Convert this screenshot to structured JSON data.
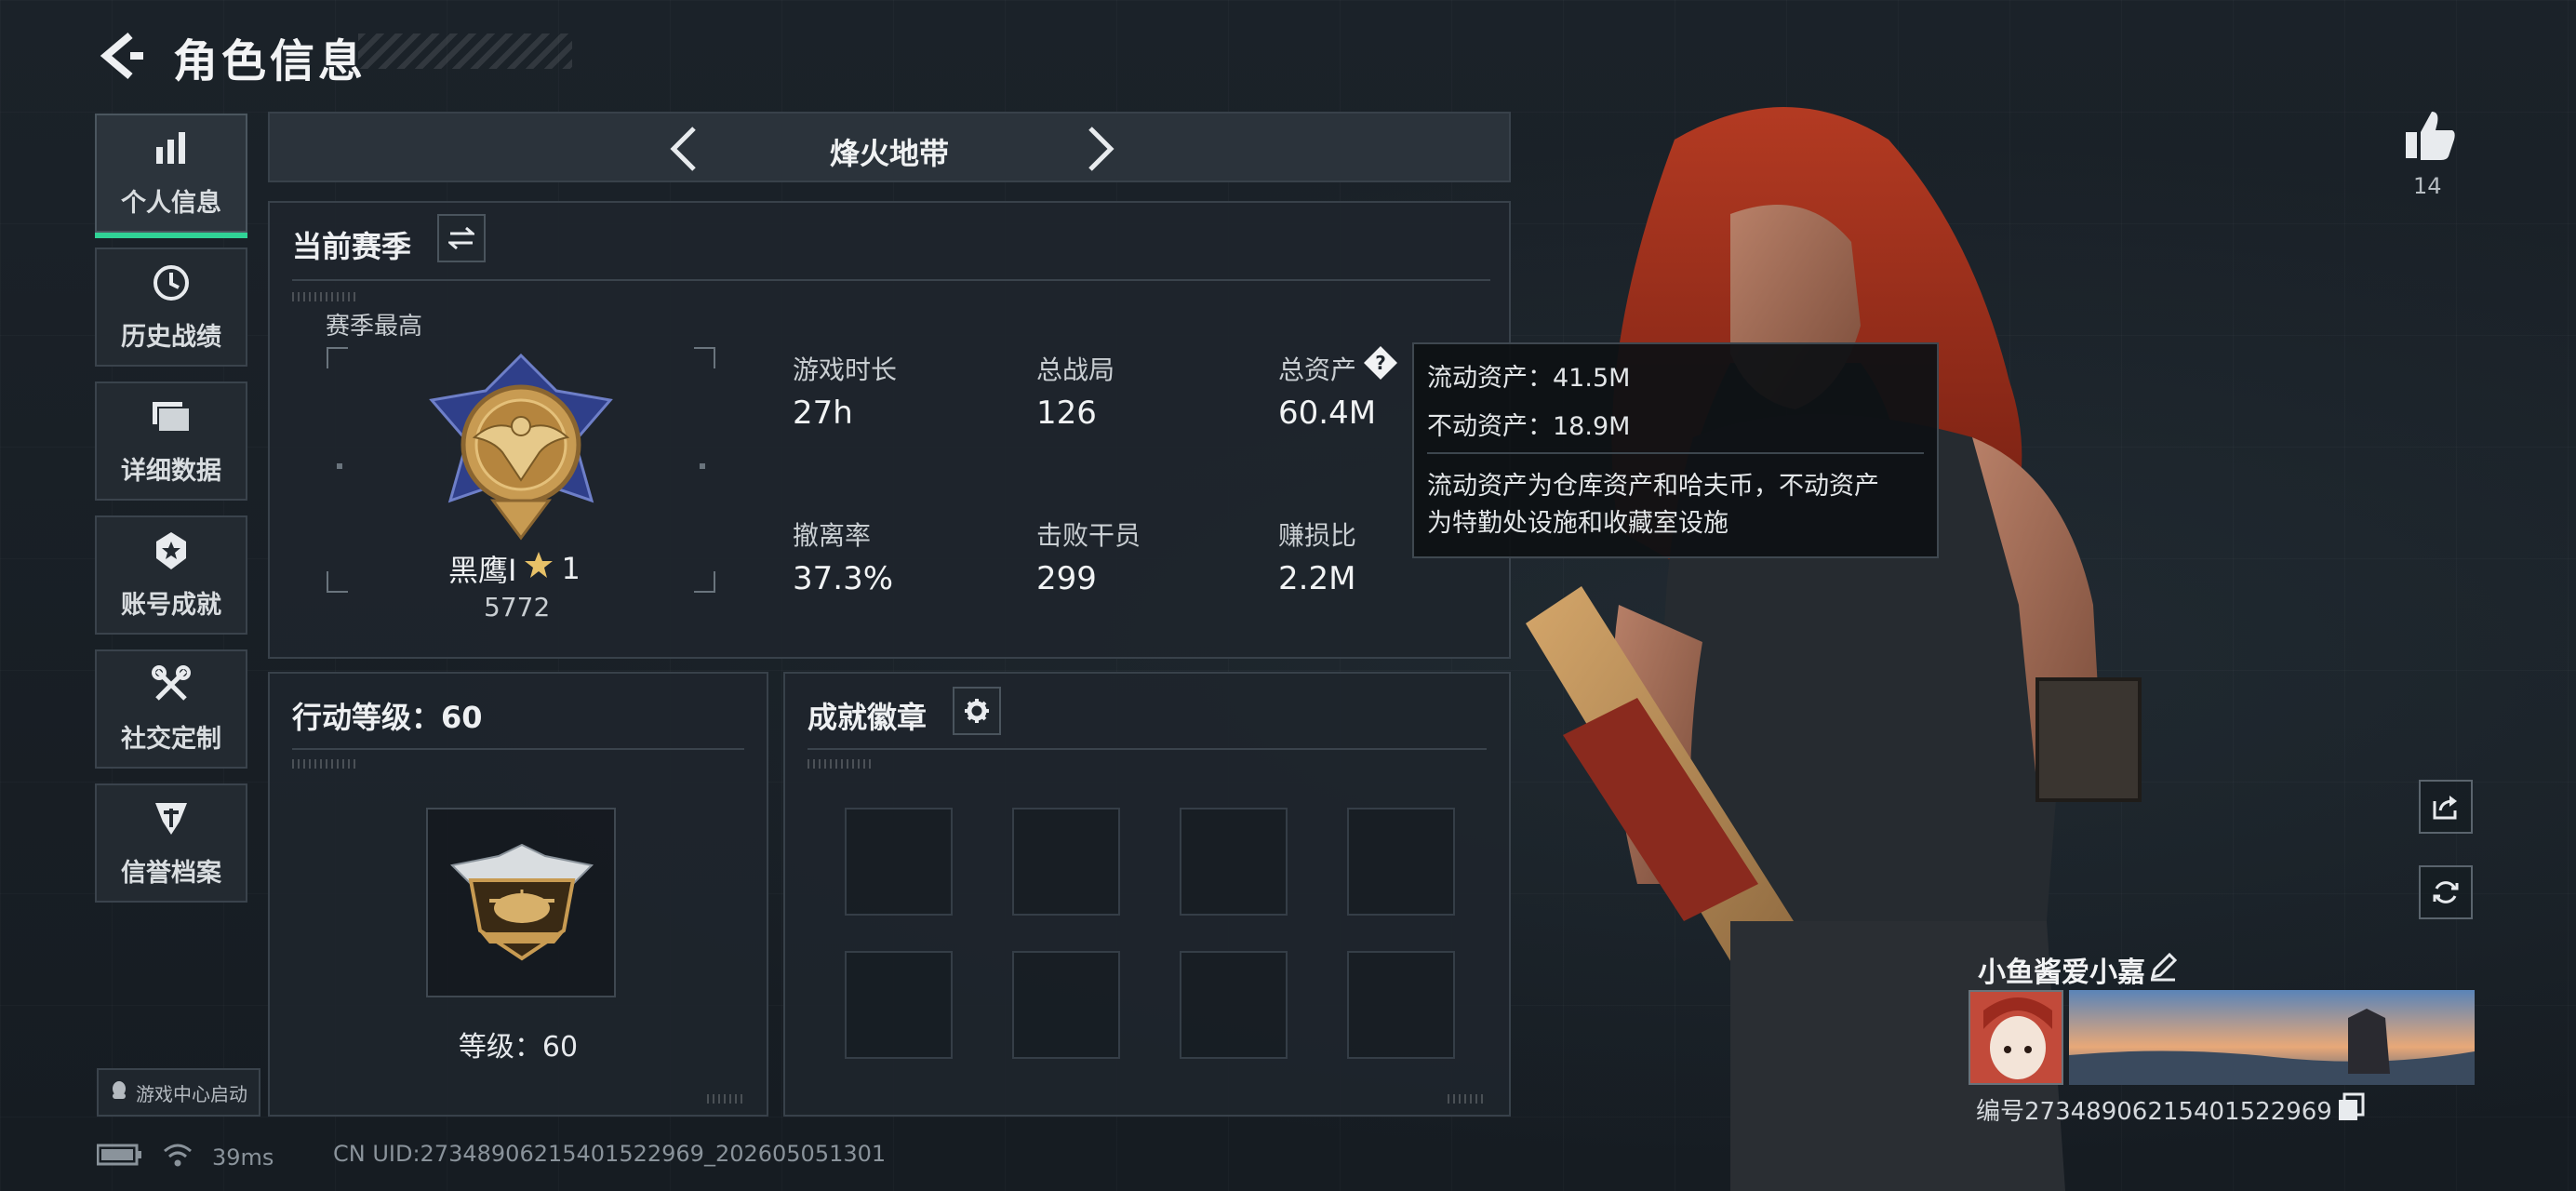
{
  "header": {
    "title": "角色信息"
  },
  "sidebar": {
    "items": [
      {
        "label": "个人信息",
        "icon": "bar-chart-icon",
        "active": true
      },
      {
        "label": "历史战绩",
        "icon": "history-clock-icon"
      },
      {
        "label": "详细数据",
        "icon": "folder-icon"
      },
      {
        "label": "账号成就",
        "icon": "medal-icon"
      },
      {
        "label": "社交定制",
        "icon": "tools-icon"
      },
      {
        "label": "信誉档案",
        "icon": "shield-icon"
      }
    ],
    "launch_label": "游戏中心启动"
  },
  "mode": {
    "title": "烽火地带"
  },
  "season": {
    "title": "当前赛季",
    "best_label": "赛季最高",
    "rank_name": "黑鹰I",
    "rank_stars": "1",
    "rank_score": "5772",
    "stats": [
      {
        "label": "游戏时长",
        "value": "27h"
      },
      {
        "label": "总战局",
        "value": "126"
      },
      {
        "label": "总资产",
        "value": "60.4M"
      },
      {
        "label": "撤离率",
        "value": "37.3%"
      },
      {
        "label": "击败干员",
        "value": "299"
      },
      {
        "label": "赚损比",
        "value": "2.2M"
      }
    ]
  },
  "tooltip": {
    "line1": "流动资产：41.5M",
    "line2": "不动资产：18.9M",
    "desc1": "流动资产为仓库资产和哈夫币，不动资产",
    "desc2": "为特勤处设施和收藏室设施"
  },
  "action_level": {
    "title": "行动等级：60",
    "level_text": "等级：60"
  },
  "badges": {
    "title": "成就徽章"
  },
  "profile": {
    "likes": "14",
    "nickname": "小鱼酱爱小嘉",
    "player_id": "编号2734890621540152296​9"
  },
  "status": {
    "ping": "39ms",
    "uid": "CN UID:2734890621540152296​9_202605051301"
  },
  "colors": {
    "accent": "#30d396",
    "panel": "#1e252c",
    "border": "#38414a"
  }
}
